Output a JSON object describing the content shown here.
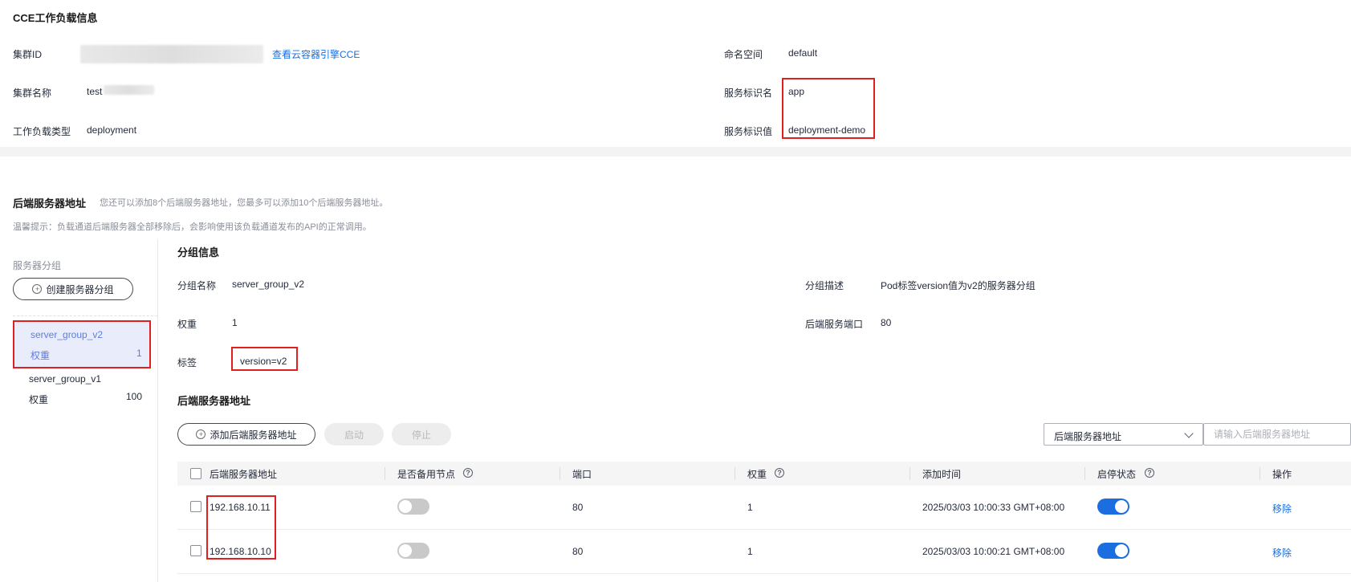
{
  "workload_section": {
    "title": "CCE工作负载信息",
    "cluster_id_label": "集群ID",
    "view_cce_link": "查看云容器引擎CCE",
    "cluster_name_label": "集群名称",
    "cluster_name_value": "test",
    "workload_type_label": "工作负载类型",
    "workload_type_value": "deployment",
    "namespace_label": "命名空间",
    "namespace_value": "default",
    "service_tag_name_label": "服务标识名",
    "service_tag_name_value": "app",
    "service_tag_value_label": "服务标识值",
    "service_tag_value_value": "deployment-demo"
  },
  "backend_section": {
    "title": "后端服务器地址",
    "subtitle": "您还可以添加8个后端服务器地址，您最多可以添加10个后端服务器地址。",
    "tip": "温馨提示：负载通道后端服务器全部移除后，会影响使用该负载通道发布的API的正常调用。"
  },
  "sidebar": {
    "title": "服务器分组",
    "create_button": "创建服务器分组",
    "groups": [
      {
        "name": "server_group_v2",
        "weight_label": "权重",
        "weight": "1"
      },
      {
        "name": "server_group_v1",
        "weight_label": "权重",
        "weight": "100"
      }
    ]
  },
  "group_info": {
    "title": "分组信息",
    "name_label": "分组名称",
    "name_value": "server_group_v2",
    "desc_label": "分组描述",
    "desc_value": "Pod标签version值为v2的服务器分组",
    "weight_label": "权重",
    "weight_value": "1",
    "port_label": "后端服务端口",
    "port_value": "80",
    "tag_label": "标签",
    "tag_value": "version=v2"
  },
  "servers": {
    "title": "后端服务器地址",
    "add_button": "添加后端服务器地址",
    "start_button": "启动",
    "stop_button": "停止",
    "filter_select": "后端服务器地址",
    "search_placeholder": "请输入后端服务器地址",
    "columns": [
      "后端服务器地址",
      "是否备用节点",
      "端口",
      "权重",
      "添加时间",
      "启停状态",
      "操作"
    ],
    "rows": [
      {
        "address": "192.168.10.11",
        "port": "80",
        "weight": "1",
        "time": "2025/03/03 10:00:33 GMT+08:00",
        "backup": false,
        "enabled": true,
        "action": "移除"
      },
      {
        "address": "192.168.10.10",
        "port": "80",
        "weight": "1",
        "time": "2025/03/03 10:00:21 GMT+08:00",
        "backup": false,
        "enabled": true,
        "action": "移除"
      }
    ]
  },
  "colors": {
    "accent": "#1a6ee0",
    "highlight_border": "#e02020",
    "selected_group_bg": "#e9ecfa"
  }
}
